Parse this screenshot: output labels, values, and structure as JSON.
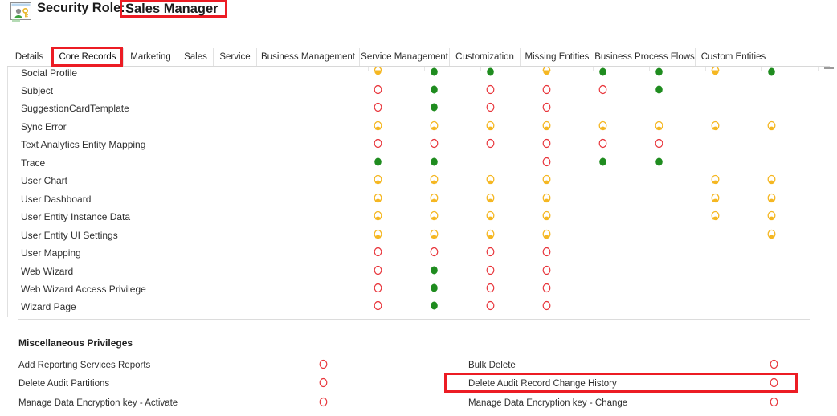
{
  "header": {
    "icon": "security-role-icon",
    "title": "Security Role:",
    "role_name": "Sales Manager",
    "highlight_color": "#ec1c24"
  },
  "tabs": [
    {
      "label": "Details",
      "selected": false
    },
    {
      "label": "Core Records",
      "selected": true
    },
    {
      "label": "Marketing",
      "selected": false
    },
    {
      "label": "Sales",
      "selected": false
    },
    {
      "label": "Service",
      "selected": false
    },
    {
      "label": "Business Management",
      "selected": false
    },
    {
      "label": "Service Management",
      "selected": false
    },
    {
      "label": "Customization",
      "selected": false
    },
    {
      "label": "Missing Entities",
      "selected": false
    },
    {
      "label": "Business Process Flows",
      "selected": false
    },
    {
      "label": "Custom Entities",
      "selected": false
    }
  ],
  "legend": {
    "none": "#e8343a",
    "user": "#f5b722",
    "organization": "#1f8c1f",
    "parent_child": "#f5b722"
  },
  "grid": {
    "privilege_columns": 8,
    "rows": [
      {
        "label": "Social Profile",
        "values": [
          "half-yellow",
          "green",
          "green",
          "half-yellow",
          "green",
          "green",
          "half-yellow",
          "green"
        ]
      },
      {
        "label": "Subject",
        "values": [
          "red",
          "green",
          "red",
          "red",
          "red",
          "green",
          "",
          ""
        ]
      },
      {
        "label": "SuggestionCardTemplate",
        "values": [
          "red",
          "green",
          "red",
          "red",
          "",
          "",
          "",
          ""
        ]
      },
      {
        "label": "Sync Error",
        "values": [
          "yellow",
          "yellow",
          "yellow",
          "yellow",
          "yellow",
          "yellow",
          "yellow",
          "yellow"
        ]
      },
      {
        "label": "Text Analytics Entity Mapping",
        "values": [
          "red",
          "red",
          "red",
          "red",
          "red",
          "red",
          "",
          ""
        ]
      },
      {
        "label": "Trace",
        "values": [
          "green",
          "green",
          "",
          "red",
          "green",
          "green",
          "",
          ""
        ]
      },
      {
        "label": "User Chart",
        "values": [
          "yellow",
          "yellow",
          "yellow",
          "yellow",
          "",
          "",
          "yellow",
          "yellow"
        ]
      },
      {
        "label": "User Dashboard",
        "values": [
          "yellow",
          "yellow",
          "yellow",
          "yellow",
          "",
          "",
          "yellow",
          "yellow"
        ]
      },
      {
        "label": "User Entity Instance Data",
        "values": [
          "yellow",
          "yellow",
          "yellow",
          "yellow",
          "",
          "",
          "yellow",
          "yellow"
        ]
      },
      {
        "label": "User Entity UI Settings",
        "values": [
          "yellow",
          "yellow",
          "yellow",
          "yellow",
          "",
          "",
          "",
          "yellow"
        ]
      },
      {
        "label": "User Mapping",
        "values": [
          "red",
          "red",
          "red",
          "red",
          "",
          "",
          "",
          ""
        ]
      },
      {
        "label": "Web Wizard",
        "values": [
          "red",
          "green",
          "red",
          "red",
          "",
          "",
          "",
          ""
        ]
      },
      {
        "label": "Web Wizard Access Privilege",
        "values": [
          "red",
          "green",
          "red",
          "red",
          "",
          "",
          "",
          ""
        ]
      },
      {
        "label": "Wizard Page",
        "values": [
          "red",
          "green",
          "red",
          "red",
          "",
          "",
          "",
          ""
        ]
      }
    ]
  },
  "misc": {
    "title": "Miscellaneous Privileges",
    "rows": [
      {
        "left_label": "Add Reporting Services Reports",
        "left_value": "red",
        "right_label": "Bulk Delete",
        "right_value": "red",
        "highlighted": false
      },
      {
        "left_label": "Delete Audit Partitions",
        "left_value": "red",
        "right_label": "Delete Audit Record Change History",
        "right_value": "red",
        "highlighted": true
      },
      {
        "left_label": "Manage Data Encryption key - Activate",
        "left_value": "red",
        "right_label": "Manage Data Encryption key - Change",
        "right_value": "red",
        "highlighted": false
      }
    ]
  }
}
